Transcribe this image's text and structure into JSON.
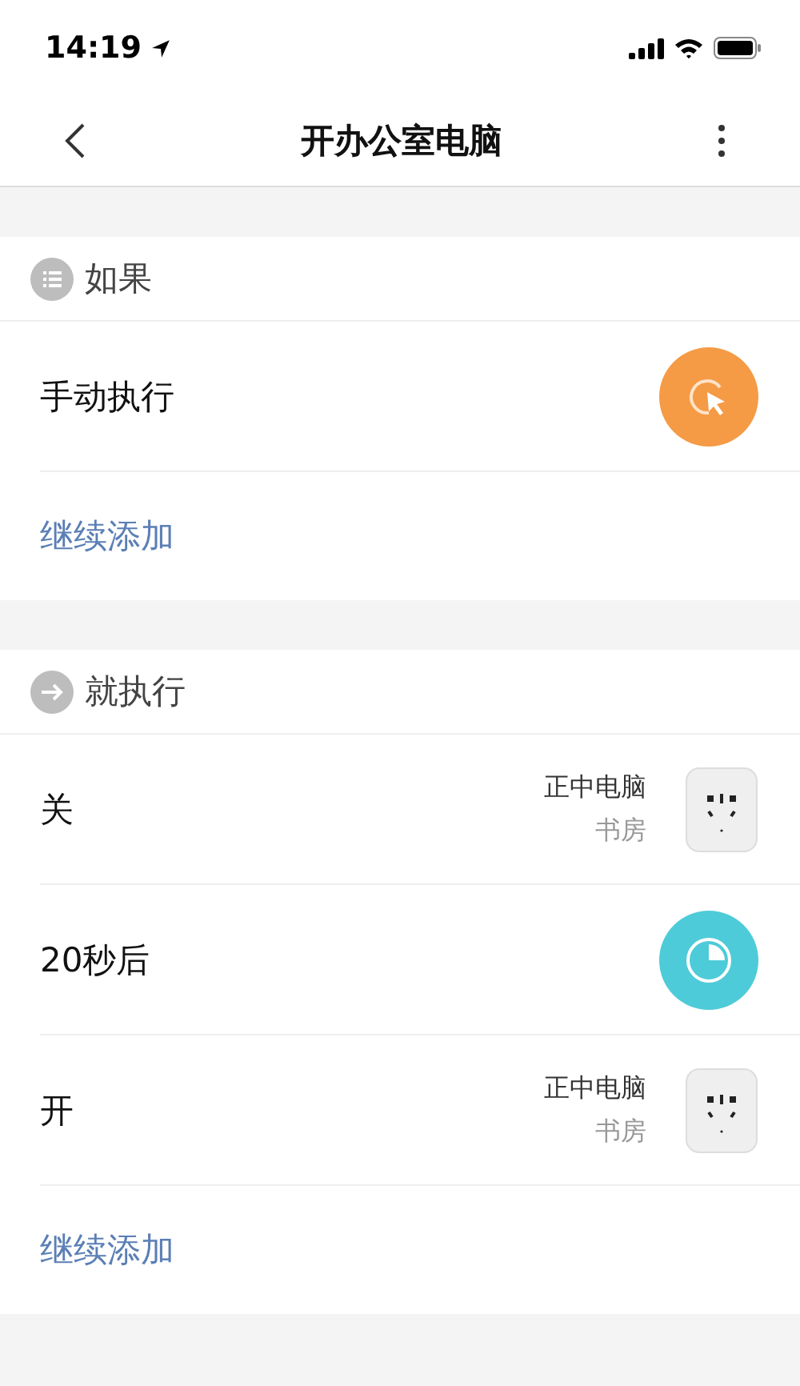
{
  "status_bar": {
    "time": "14:19"
  },
  "nav": {
    "title": "开办公室电脑"
  },
  "sections": [
    {
      "title": "如果",
      "kind": "condition",
      "items": [
        {
          "kind": "manual",
          "label": "手动执行"
        }
      ],
      "add": "继续添加"
    },
    {
      "title": "就执行",
      "kind": "action",
      "items": [
        {
          "kind": "device",
          "label": "关",
          "device": "正中电脑",
          "room": "书房"
        },
        {
          "kind": "delay",
          "label": "20秒后"
        },
        {
          "kind": "device",
          "label": "开",
          "device": "正中电脑",
          "room": "书房"
        }
      ],
      "add": "继续添加"
    }
  ]
}
